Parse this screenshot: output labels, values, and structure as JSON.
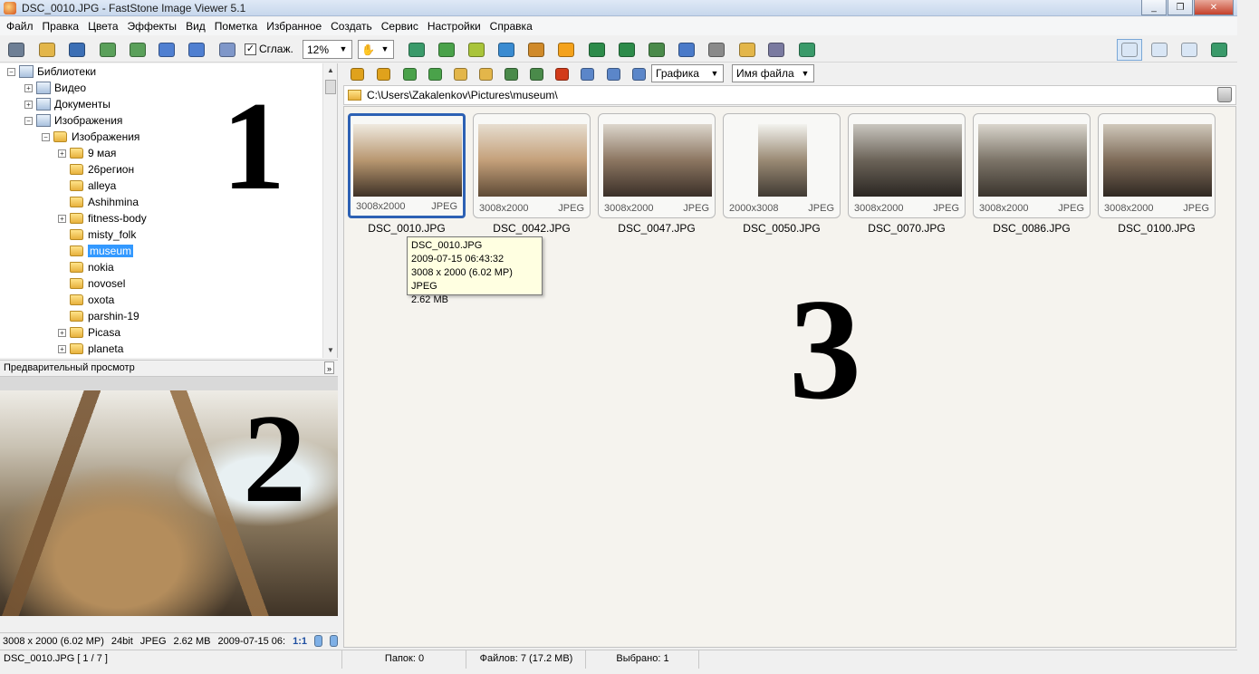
{
  "window": {
    "title": "DSC_0010.JPG  -  FastStone Image Viewer 5.1",
    "minimize_glyph": "_",
    "maximize_glyph": "❐",
    "close_glyph": "✕"
  },
  "menu": [
    "Файл",
    "Правка",
    "Цвета",
    "Эффекты",
    "Вид",
    "Пометка",
    "Избранное",
    "Создать",
    "Сервис",
    "Настройки",
    "Справка"
  ],
  "toolbar": {
    "smooth_label": "Сглаж.",
    "smooth_checked": "✓",
    "zoom_value": "12%",
    "hand_glyph": "✋",
    "dropdown_glyph": "▼",
    "icons": [
      "camera-icon",
      "open-folder-icon",
      "save-icon",
      "prev-image-icon",
      "next-image-icon",
      "zoom-in-icon",
      "zoom-out-icon",
      "actual-size-icon",
      "slideshow-icon",
      "import-icon",
      "crop-icon",
      "resize-icon",
      "color-icon",
      "brightness-icon",
      "rotate-left-icon",
      "rotate-right-icon",
      "compare-icon",
      "capture-icon",
      "draw-icon",
      "email-icon",
      "print-icon",
      "checklist-icon"
    ],
    "view_modes": [
      "browser-view-icon",
      "preview-view-icon",
      "portrait-view-icon",
      "fullscreen-view-icon"
    ]
  },
  "tree": {
    "items": [
      {
        "label": "Библиотеки",
        "level": 0,
        "expander": "−",
        "icon": "library-icon"
      },
      {
        "label": "Видео",
        "level": 1,
        "expander": "+",
        "icon": "video-library-icon"
      },
      {
        "label": "Документы",
        "level": 1,
        "expander": "+",
        "icon": "documents-library-icon"
      },
      {
        "label": "Изображения",
        "level": 1,
        "expander": "−",
        "icon": "pictures-library-icon"
      },
      {
        "label": "Изображения",
        "level": 2,
        "expander": "−",
        "icon": "folder-icon"
      },
      {
        "label": "9 мая",
        "level": 3,
        "expander": "+",
        "icon": "folder-icon"
      },
      {
        "label": "26регион",
        "level": 3,
        "expander": "",
        "icon": "folder-icon"
      },
      {
        "label": "alleya",
        "level": 3,
        "expander": "",
        "icon": "folder-icon"
      },
      {
        "label": "Ashihmina",
        "level": 3,
        "expander": "",
        "icon": "folder-icon"
      },
      {
        "label": "fitness-body",
        "level": 3,
        "expander": "+",
        "icon": "folder-icon"
      },
      {
        "label": "misty_folk",
        "level": 3,
        "expander": "",
        "icon": "folder-icon"
      },
      {
        "label": "museum",
        "level": 3,
        "expander": "",
        "icon": "folder-icon",
        "selected": true
      },
      {
        "label": "nokia",
        "level": 3,
        "expander": "",
        "icon": "folder-icon"
      },
      {
        "label": "novosel",
        "level": 3,
        "expander": "",
        "icon": "folder-icon"
      },
      {
        "label": "oxota",
        "level": 3,
        "expander": "",
        "icon": "folder-icon"
      },
      {
        "label": "parshin-19",
        "level": 3,
        "expander": "",
        "icon": "folder-icon"
      },
      {
        "label": "Picasa",
        "level": 3,
        "expander": "+",
        "icon": "folder-icon"
      },
      {
        "label": "planeta",
        "level": 3,
        "expander": "+",
        "icon": "folder-icon"
      }
    ],
    "scroll_up": "▲",
    "scroll_down": "▼"
  },
  "annotations": {
    "one": "1",
    "two": "2",
    "three": "3"
  },
  "preview": {
    "header": "Предварительный просмотр",
    "collapse_glyph": "»",
    "status": {
      "dimensions": "3008 x 2000 (6.02 MP)",
      "bits": "24bit",
      "format": "JPEG",
      "size": "2.62 MB",
      "date": "2009-07-15 06:",
      "ratio": "1:1"
    }
  },
  "browser_toolbar": {
    "icons": [
      "back-icon",
      "forward-icon",
      "up-folder-icon",
      "refresh-icon",
      "new-folder-icon",
      "favorites-icon",
      "copy-to-icon",
      "move-to-icon",
      "delete-icon",
      "thumbnails-view-icon",
      "list-view-icon",
      "details-view-icon"
    ],
    "filter_value": "Графика",
    "sort_value": "Имя файла"
  },
  "path": "C:\\Users\\Zakalenkov\\Pictures\\museum\\",
  "thumbnails": [
    {
      "name": "DSC_0010.JPG",
      "dims": "3008x2000",
      "type": "JPEG",
      "selected": true
    },
    {
      "name": "DSC_0042.JPG",
      "dims": "3008x2000",
      "type": "JPEG"
    },
    {
      "name": "DSC_0047.JPG",
      "dims": "3008x2000",
      "type": "JPEG"
    },
    {
      "name": "DSC_0050.JPG",
      "dims": "2000x3008",
      "type": "JPEG",
      "portrait": true
    },
    {
      "name": "DSC_0070.JPG",
      "dims": "3008x2000",
      "type": "JPEG"
    },
    {
      "name": "DSC_0086.JPG",
      "dims": "3008x2000",
      "type": "JPEG"
    },
    {
      "name": "DSC_0100.JPG",
      "dims": "3008x2000",
      "type": "JPEG"
    }
  ],
  "tooltip": {
    "line1": "DSC_0010.JPG",
    "line2": "2009-07-15 06:43:32",
    "line3": "3008 x 2000 (6.02 MP)  JPEG",
    "line4": "2.62 MB"
  },
  "status": {
    "file": "DSC_0010.JPG [ 1 / 7 ]",
    "folders": "Папок: 0",
    "files": "Файлов: 7 (17.2 MB)",
    "selected": "Выбрано: 1"
  }
}
